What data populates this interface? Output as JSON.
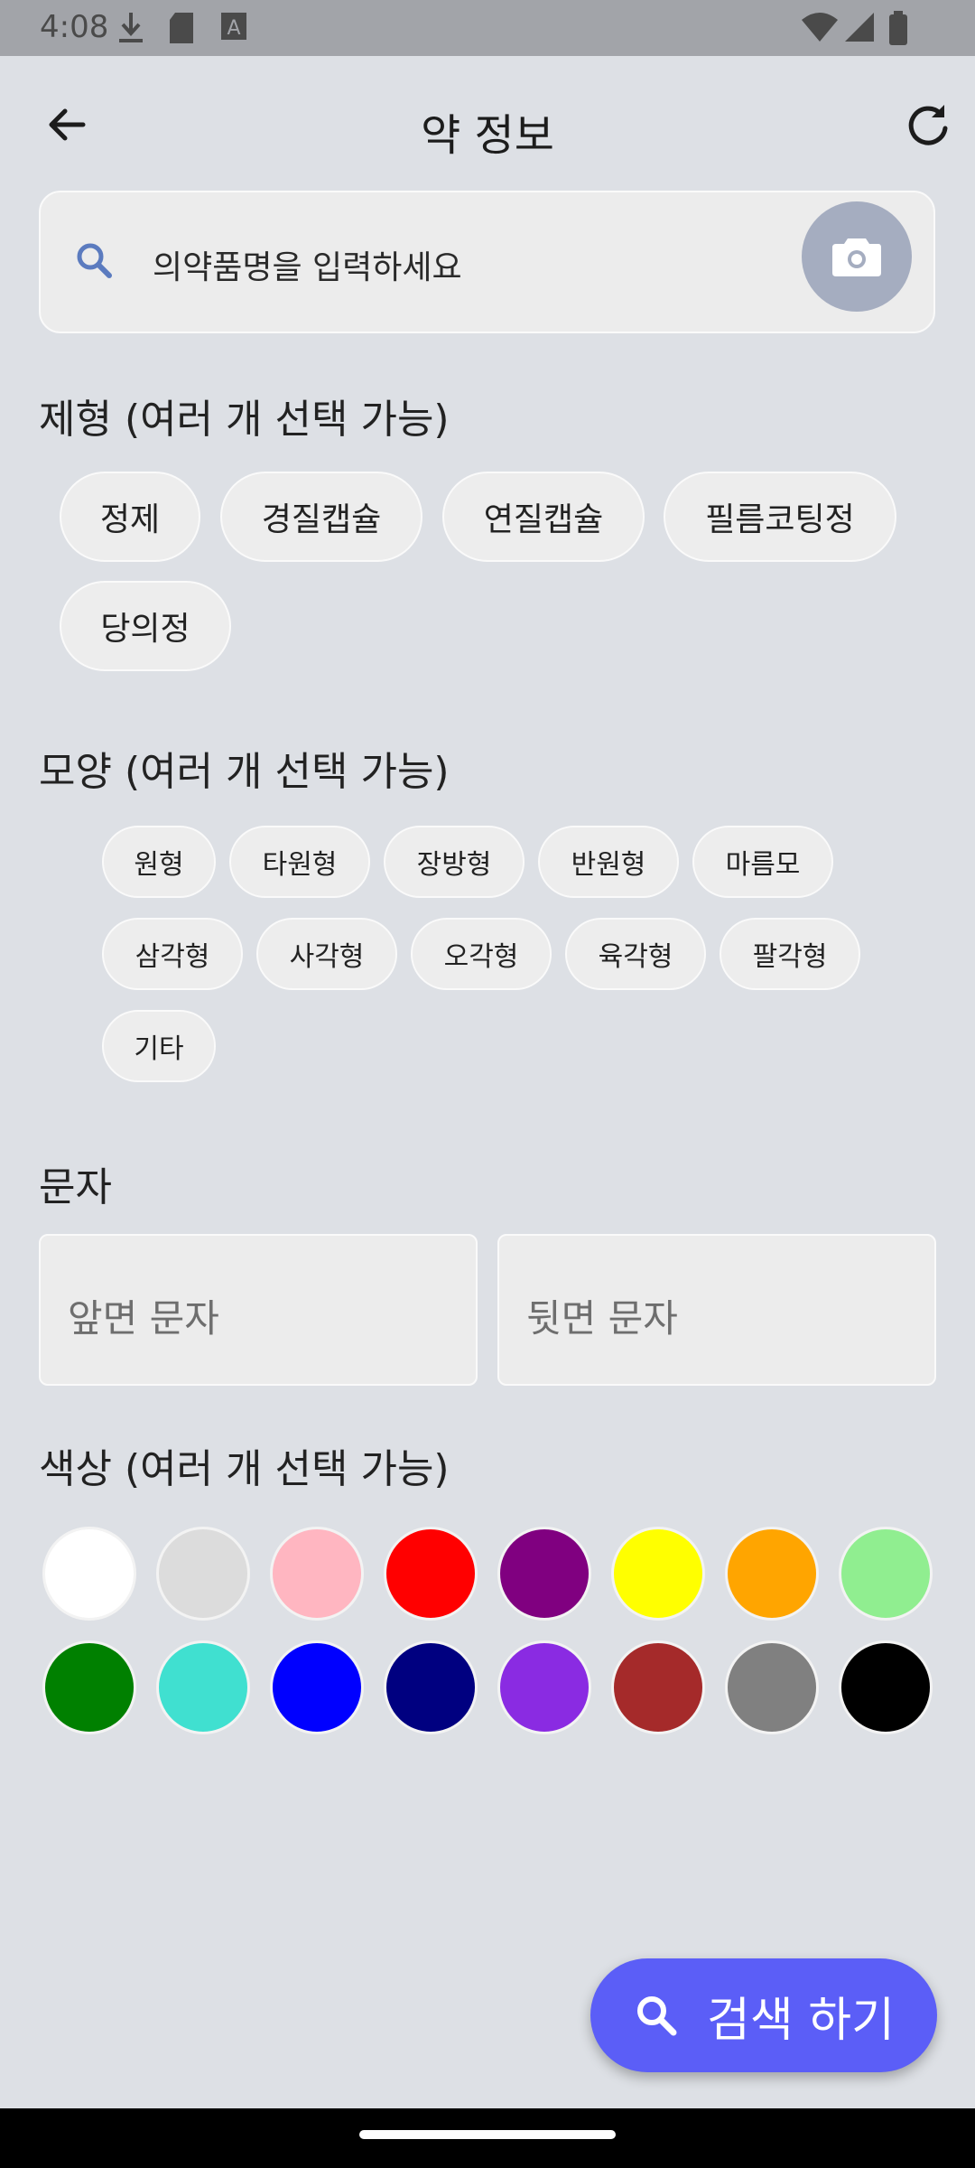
{
  "status_bar": {
    "time": "4:08"
  },
  "header": {
    "title": "약 정보"
  },
  "search": {
    "placeholder": "의약품명을 입력하세요"
  },
  "dosage_form": {
    "title": "제형 (여러 개 선택 가능)",
    "chips": [
      "정제",
      "경질캡슐",
      "연질캡슐",
      "필름코팅정",
      "당의정"
    ]
  },
  "shape": {
    "title": "모양 (여러 개 선택 가능)",
    "chips": [
      "원형",
      "타원형",
      "장방형",
      "반원형",
      "마름모",
      "삼각형",
      "사각형",
      "오각형",
      "육각형",
      "팔각형",
      "기타"
    ]
  },
  "imprint": {
    "title": "문자",
    "front_placeholder": "앞면 문자",
    "back_placeholder": "뒷면 문자"
  },
  "color": {
    "title": "색상 (여러 개 선택 가능)",
    "swatches": [
      "#ffffff",
      "#dcdcdc",
      "#ffb6c1",
      "#ff0000",
      "#800080",
      "#ffff00",
      "#ffa500",
      "#90ee90",
      "#008000",
      "#40e0d0",
      "#0000ff",
      "#000080",
      "#8a2be2",
      "#a52a2a",
      "#808080",
      "#000000"
    ]
  },
  "fab": {
    "label": "검색 하기"
  },
  "accent_color": "#5b5ef7"
}
